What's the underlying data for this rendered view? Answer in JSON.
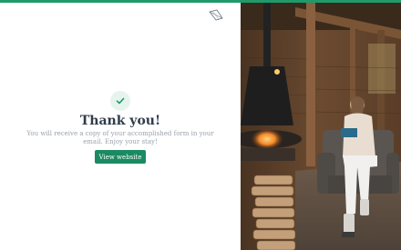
{
  "thank_you": {
    "title": "Thank you!",
    "message": "You will receive a copy of your accomplished form in your email. Enjoy your stay!",
    "button_label": "View website"
  },
  "colors": {
    "accent": "#1f9a6a",
    "button": "#1b8a62",
    "title": "#2e3c4c",
    "muted_text": "#9aa3ad"
  },
  "icons": {
    "logo": "feather-leaf-icon",
    "success": "check-icon"
  }
}
